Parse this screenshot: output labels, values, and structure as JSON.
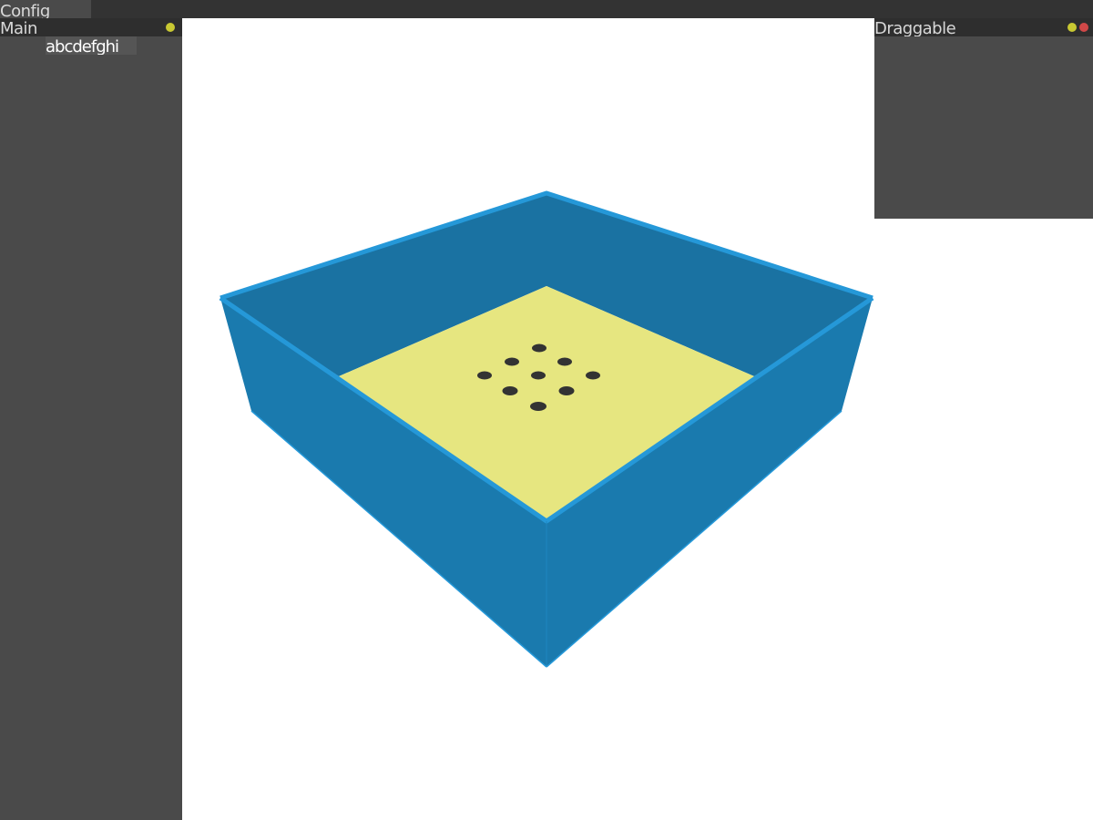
{
  "menu": {
    "config_label": "Config"
  },
  "main_panel": {
    "title": "Main",
    "text_field_value": "abcdefghi"
  },
  "draggable_panel": {
    "title": "Draggable"
  },
  "colors": {
    "menubar_bg": "#333333",
    "panel_bg": "#4a4a4a",
    "titlebar_bg": "#2e2e2e",
    "dot_yellow": "#c8c832",
    "dot_red": "#d04848",
    "box_blue": "#1a7aae",
    "box_blue_edge": "#2598d8",
    "floor_yellow": "#e6e680",
    "dot_dark": "#333333"
  },
  "icons": {
    "minimize": "yellow-circle-icon",
    "close": "red-circle-icon"
  }
}
